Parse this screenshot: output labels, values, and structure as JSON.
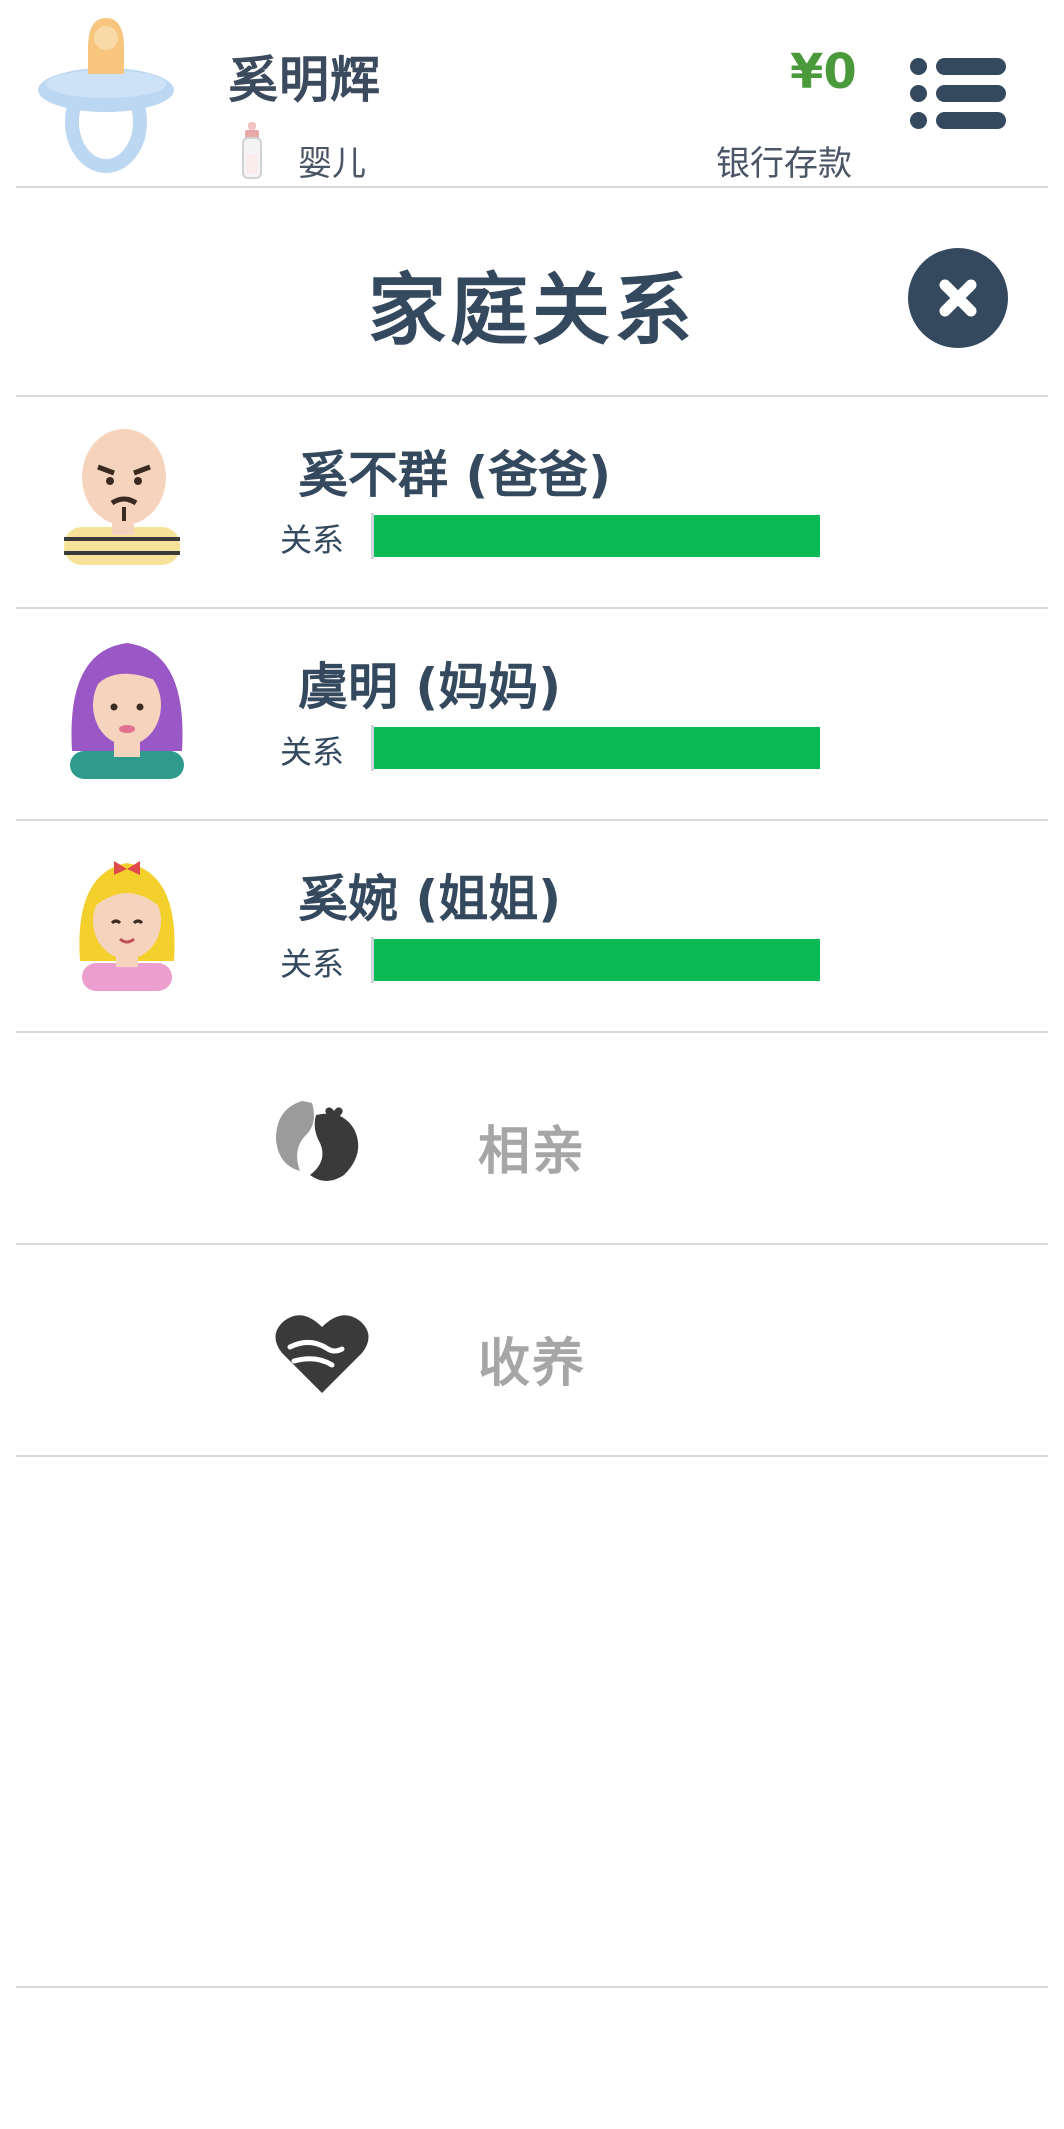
{
  "header": {
    "player_name": "奚明辉",
    "life_stage": "婴儿",
    "money_value": "¥0",
    "money_label": "银行存款",
    "avatar_icon": "pacifier-icon",
    "stage_icon": "baby-bottle-icon",
    "menu_icon": "list-menu-icon"
  },
  "page": {
    "title": "家庭关系",
    "close_icon": "close-icon"
  },
  "family": {
    "relation_label": "关系",
    "members": [
      {
        "name": "奚不群 (爸爸)",
        "relationship": 1.0,
        "portrait": "father-portrait-icon"
      },
      {
        "name": "虞明 (妈妈)",
        "relationship": 1.0,
        "portrait": "mother-portrait-icon"
      },
      {
        "name": "奚婉 (姐姐)",
        "relationship": 1.0,
        "portrait": "sister-portrait-icon"
      }
    ]
  },
  "actions": [
    {
      "label": "相亲",
      "icon": "matchmaking-icon"
    },
    {
      "label": "收养",
      "icon": "adoption-heart-icon"
    }
  ],
  "colors": {
    "primary": "#34495e",
    "money": "#4a9a3c",
    "relationship_bar": "#0cba55",
    "muted_text": "#a6a6a6",
    "divider": "#d9d9d9"
  }
}
